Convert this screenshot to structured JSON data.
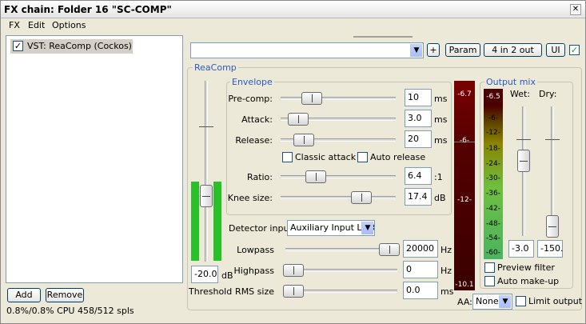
{
  "window": {
    "title": "FX chain: Folder 16 \"SC-COMP\"",
    "close_glyph": "✕"
  },
  "menu": [
    "FX",
    "Edit",
    "Options"
  ],
  "fx_list": {
    "items": [
      {
        "label": "VST: ReaComp (Cockos)",
        "enabled": true
      }
    ]
  },
  "buttons": {
    "add": "Add",
    "remove": "Remove",
    "param": "Param",
    "routing": "4 in 2 out",
    "ui": "UI",
    "plus": "+"
  },
  "cpu_status": "0.8%/0.8% CPU 458/512 spls",
  "preset": {
    "value": ""
  },
  "plugin": {
    "name": "ReaComp",
    "envelope": {
      "title": "Envelope",
      "precomp": {
        "label": "Pre-comp:",
        "value": "10",
        "unit": "ms"
      },
      "attack": {
        "label": "Attack:",
        "value": "3.0",
        "unit": "ms"
      },
      "release": {
        "label": "Release:",
        "value": "20",
        "unit": "ms"
      },
      "classic_attack": "Classic attack",
      "auto_release": "Auto release",
      "ratio": {
        "label": "Ratio:",
        "value": "6.4",
        "unit": ":1"
      },
      "knee": {
        "label": "Knee size:",
        "value": "17.4",
        "unit": "dB"
      }
    },
    "threshold": {
      "label": "Threshold",
      "value": "-20.0",
      "unit": "dB"
    },
    "detector": {
      "label": "Detector input:",
      "value": "Auxiliary Input L+R"
    },
    "lowpass": {
      "label": "Lowpass",
      "value": "20000",
      "unit": "Hz"
    },
    "highpass": {
      "label": "Highpass",
      "value": "0",
      "unit": "Hz"
    },
    "rms": {
      "label": "RMS size",
      "value": "0.0",
      "unit": "ms"
    },
    "gr_meter": [
      "-6.7",
      "-6-",
      "-12-",
      "-10.1"
    ],
    "output_mix": {
      "title": "Output mix",
      "scale": [
        "-6.5",
        "-6-",
        "-12-",
        "-18-",
        "-24-",
        "-30-",
        "-36-",
        "-42-",
        "-48-",
        "-54-",
        "-60-"
      ],
      "wet": {
        "label": "Wet:",
        "value": "-3.0"
      },
      "dry": {
        "label": "Dry:",
        "value": "-150."
      },
      "preview_filter": "Preview filter",
      "auto_makeup": "Auto make-up"
    },
    "aa": {
      "label": "AA:",
      "value": "None"
    },
    "limit_output": "Limit output"
  }
}
